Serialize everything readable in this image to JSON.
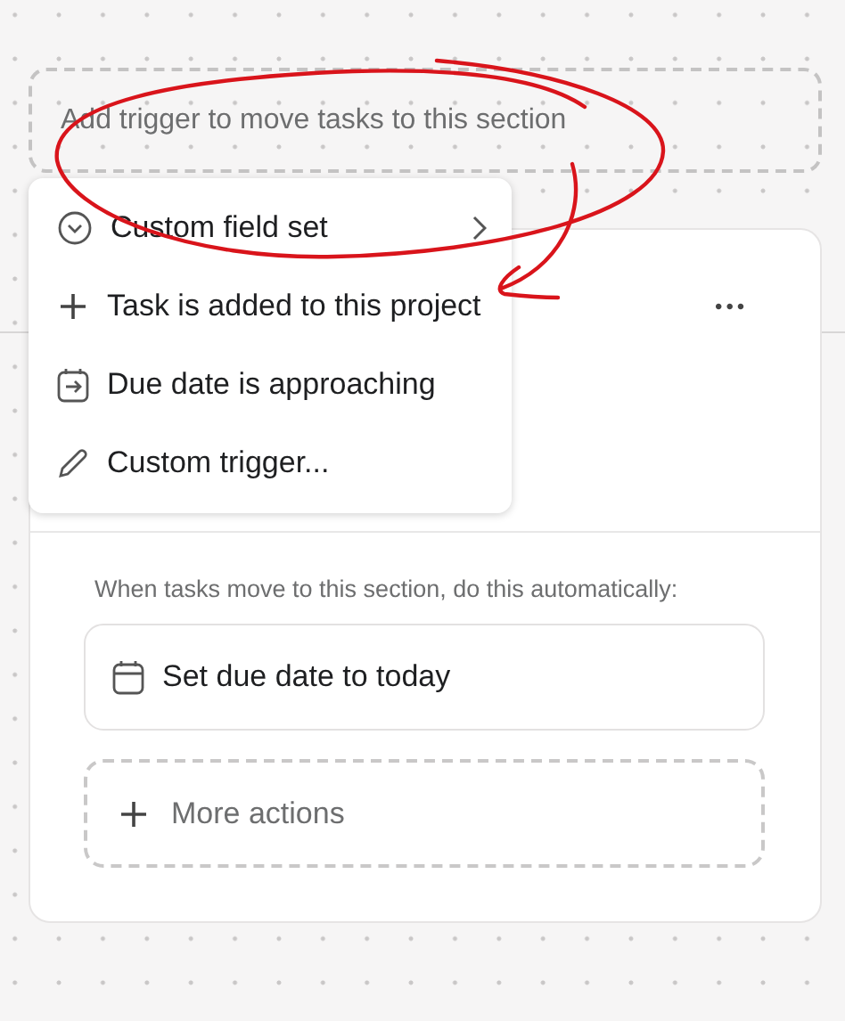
{
  "trigger_box": {
    "placeholder": "Add trigger to move tasks to this section"
  },
  "trigger_menu": {
    "items": [
      {
        "kind": "field",
        "label": "Custom field set",
        "submenu": true
      },
      {
        "kind": "added",
        "label": "Task is added to this project",
        "submenu": false
      },
      {
        "kind": "due",
        "label": "Due date is approaching",
        "submenu": false
      },
      {
        "kind": "custom",
        "label": "Custom trigger...",
        "submenu": false
      }
    ]
  },
  "section_card": {
    "more_menu": "•••",
    "rule_text": "When tasks move to this section, do this automatically:",
    "actions": [
      {
        "kind": "due-date",
        "label": "Set due date to today"
      }
    ],
    "add_action": {
      "label": "More actions"
    }
  }
}
